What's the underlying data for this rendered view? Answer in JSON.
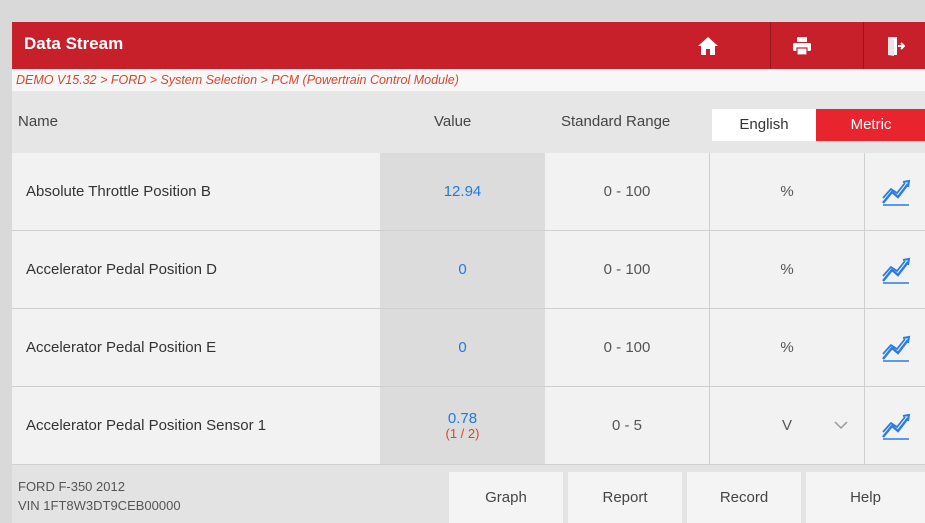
{
  "header": {
    "title": "Data Stream",
    "home_icon": "home-icon",
    "print_icon": "print-icon",
    "exit_icon": "exit-icon"
  },
  "breadcrumb": "DEMO V15.32 > FORD > System Selection > PCM (Powertrain Control Module)",
  "columns": {
    "name": "Name",
    "value": "Value",
    "range": "Standard Range",
    "english": "English",
    "metric": "Metric",
    "selected_unit": "Metric"
  },
  "rows": [
    {
      "name": "Absolute Throttle Position B",
      "value": "12.94",
      "range": "0 - 100",
      "unit": "%"
    },
    {
      "name": "Accelerator Pedal Position D",
      "value": "0",
      "range": "0 - 100",
      "unit": "%"
    },
    {
      "name": "Accelerator Pedal Position E",
      "value": "0",
      "range": "0 - 100",
      "unit": "%"
    },
    {
      "name": "Accelerator Pedal Position Sensor 1",
      "value": "0.78",
      "page": "(1 / 2)",
      "range": "0 - 5",
      "unit": "V"
    }
  ],
  "footer": {
    "vehicle": "FORD F-350 2012",
    "vin": "VIN 1FT8W3DT9CEB00000",
    "buttons": [
      "Graph",
      "Report",
      "Record",
      "Help"
    ]
  },
  "colors": {
    "header": "#c8202a",
    "metric_active": "#e8242e",
    "value_text": "#1e7be0",
    "breadcrumb_text": "#d9452b",
    "graph_icon": "#2a7de1"
  }
}
